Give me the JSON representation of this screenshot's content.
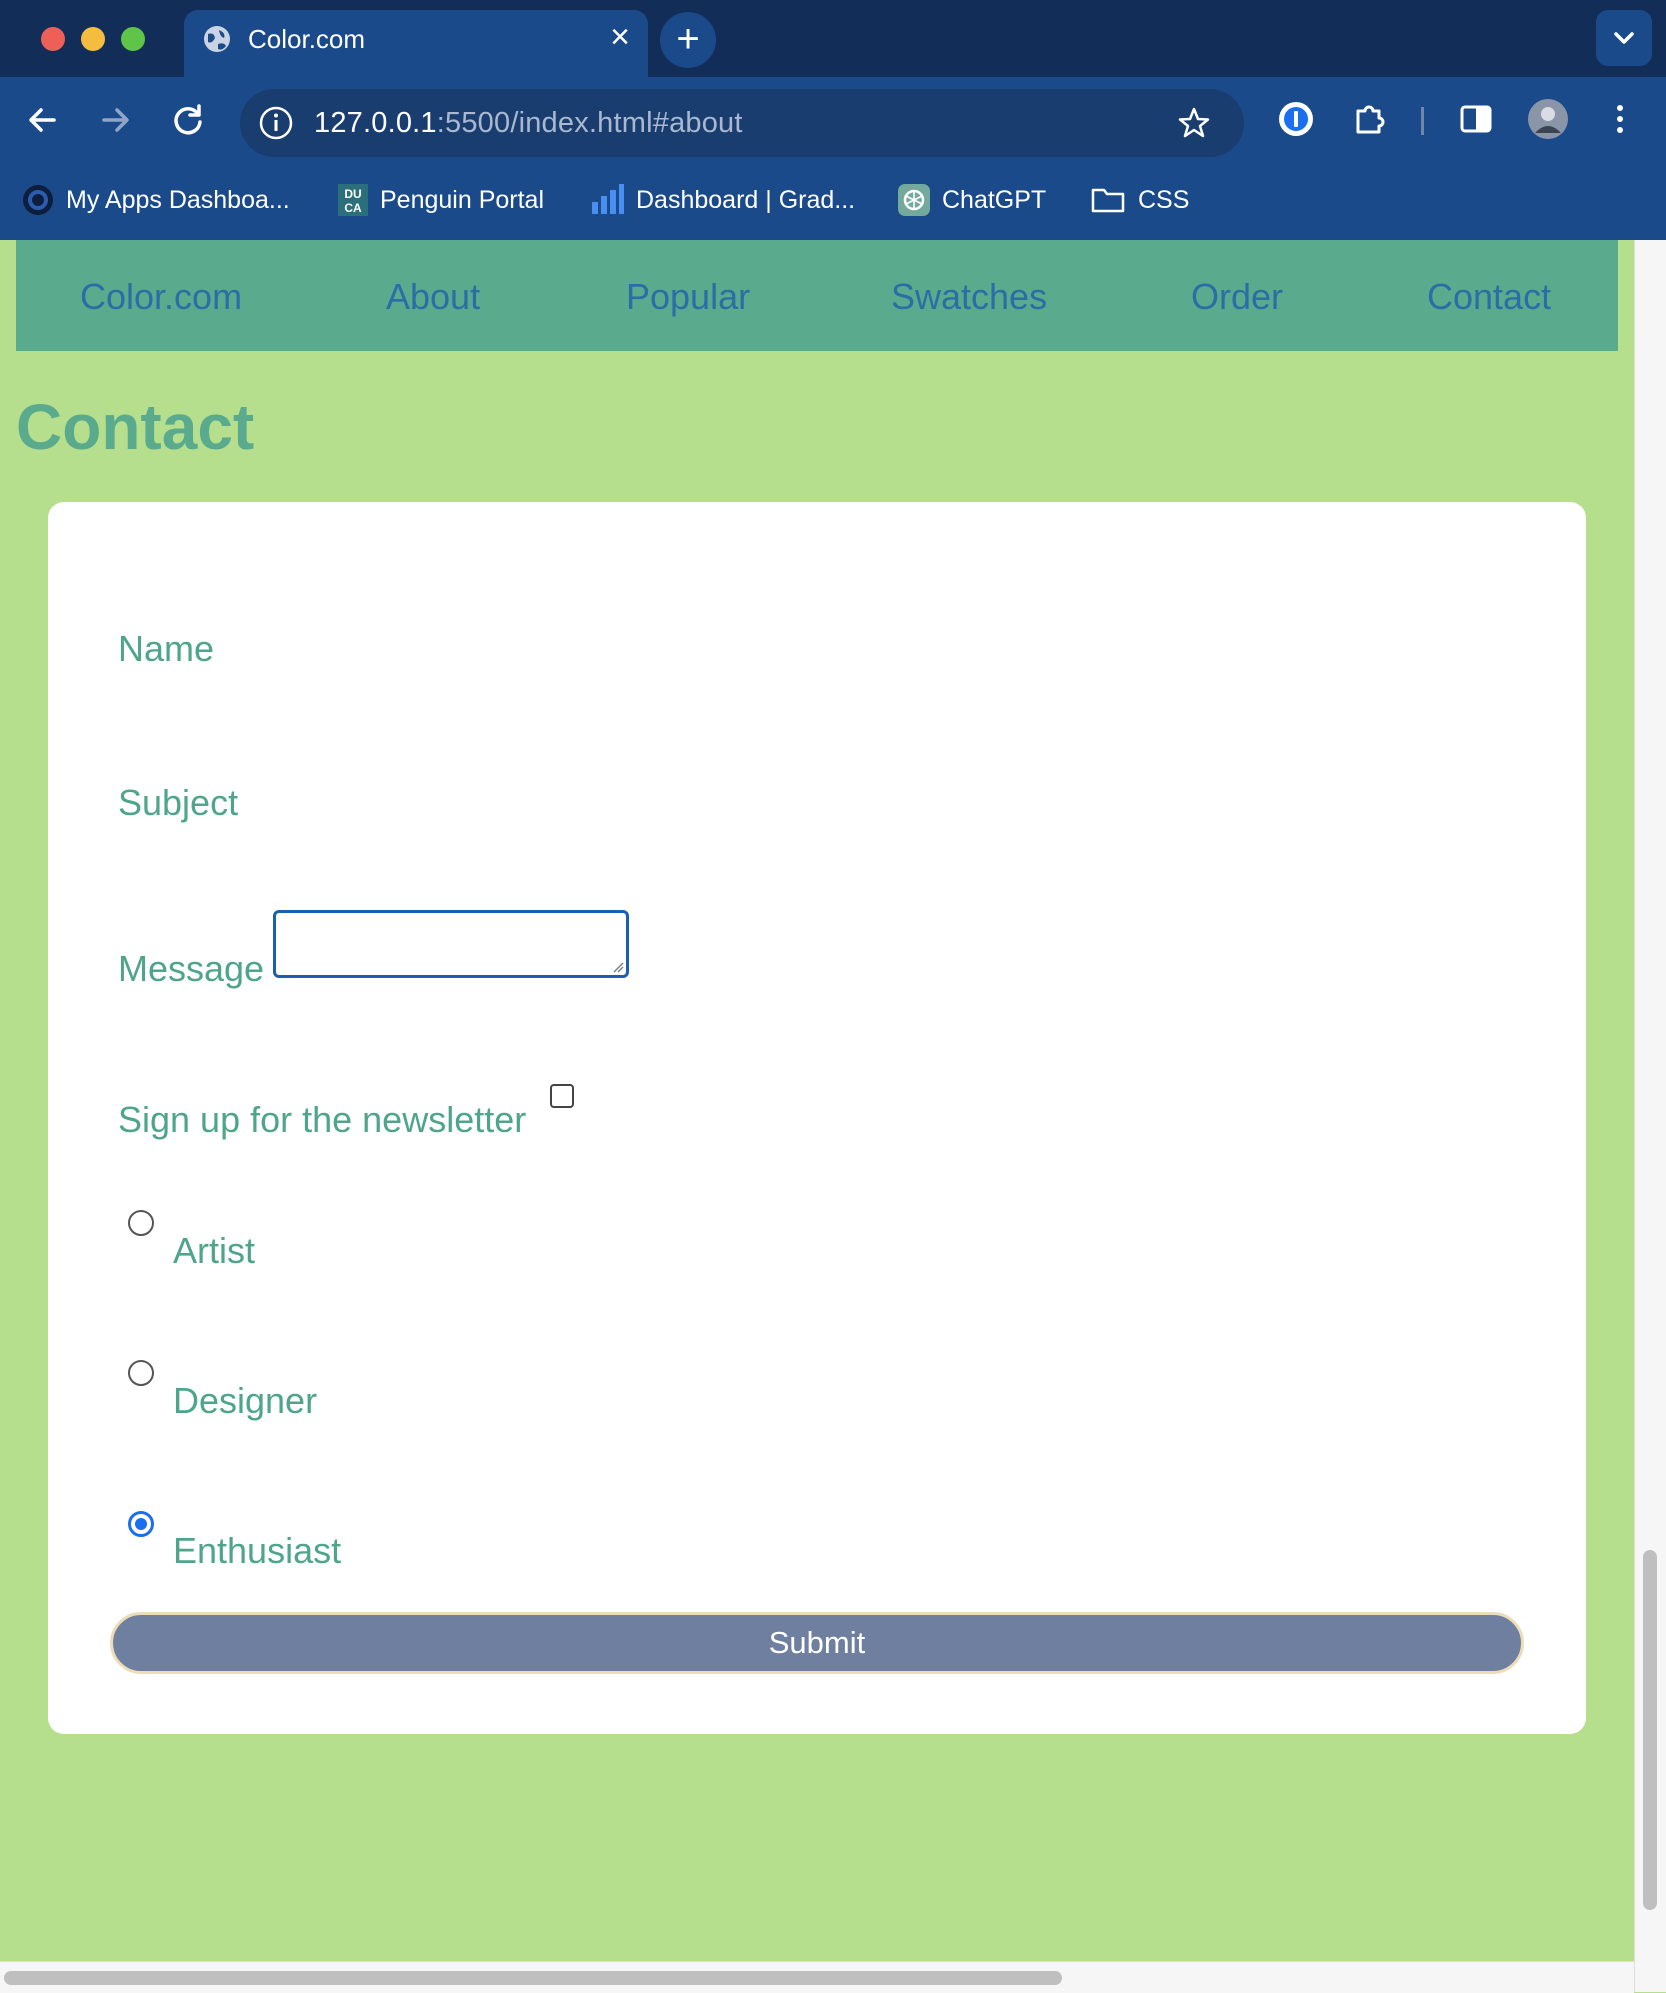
{
  "browser": {
    "tab_title": "Color.com",
    "url_host": "127.0.0.1",
    "url_rest": ":5500/index.html#about",
    "bookmarks": [
      {
        "label": "My Apps Dashboa...",
        "icon": "circle-logo-icon"
      },
      {
        "label": "Penguin Portal",
        "icon": "duca-logo-icon"
      },
      {
        "label": "Dashboard | Grad...",
        "icon": "bar-chart-icon"
      },
      {
        "label": "ChatGPT",
        "icon": "chatgpt-icon"
      },
      {
        "label": "CSS",
        "icon": "folder-icon"
      }
    ]
  },
  "site_nav": {
    "items": [
      "Color.com",
      "About",
      "Popular",
      "Swatches",
      "Order",
      "Contact"
    ]
  },
  "contact": {
    "heading": "Contact",
    "name_label": "Name",
    "subject_label": "Subject",
    "message_label": "Message",
    "newsletter_label": "Sign up for the newsletter",
    "newsletter_checked": false,
    "roles": [
      {
        "label": "Artist",
        "selected": false
      },
      {
        "label": "Designer",
        "selected": false
      },
      {
        "label": "Enthusiast",
        "selected": true
      }
    ],
    "submit_label": "Submit"
  },
  "colors": {
    "page_bg": "#b5de8d",
    "nav_bg": "#5aaa8e",
    "nav_text": "#2a6ea6",
    "label_text": "#4ea58a",
    "submit_bg": "#6e7fa0"
  }
}
